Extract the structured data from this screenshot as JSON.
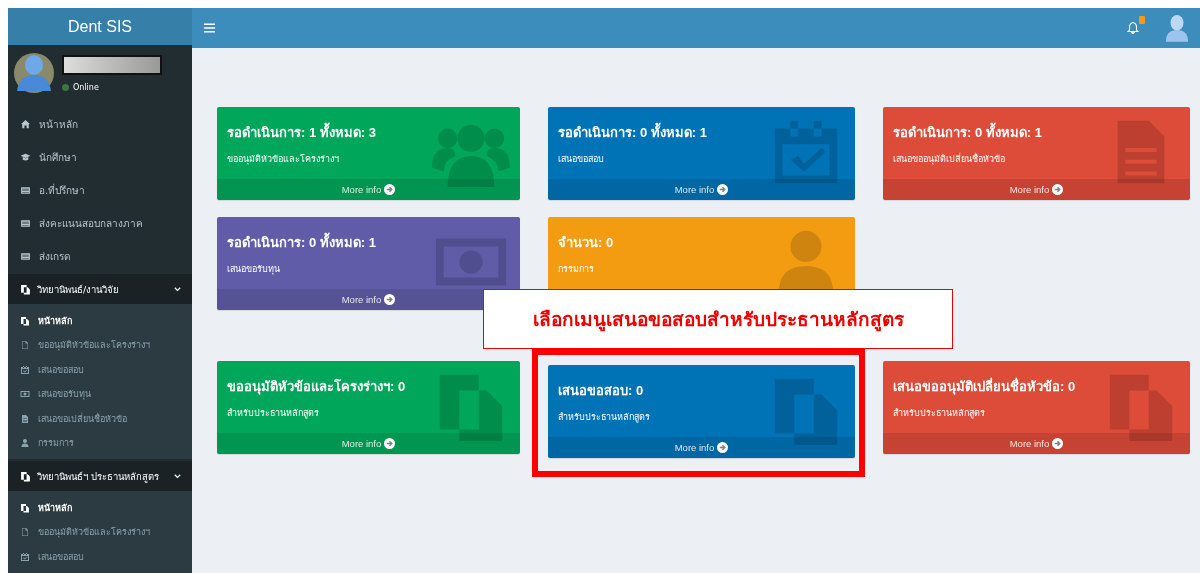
{
  "brand": "Dent SIS",
  "user": {
    "status": "Online"
  },
  "notifications": {
    "unread": true
  },
  "menu": [
    {
      "label": "หน้าหลัก"
    },
    {
      "label": "นักศึกษา"
    },
    {
      "label": "อ.ที่ปรึกษา"
    },
    {
      "label": "ส่งคะแนนสอบกลางภาค"
    },
    {
      "label": "ส่งเกรด"
    }
  ],
  "sections": [
    {
      "label": "วิทยานิพนธ์/งานวิจัย",
      "expanded": true,
      "items": [
        {
          "label": "หน้าหลัก",
          "selected": true
        },
        {
          "label": "ขออนุมัติหัวข้อและโครงร่างฯ",
          "selected": false
        },
        {
          "label": "เสนอขอสอบ",
          "selected": false
        },
        {
          "label": "เสนอขอรับทุน",
          "selected": false
        },
        {
          "label": "เสนอขอเปลี่ยนชื่อหัวข้อ",
          "selected": false
        },
        {
          "label": "กรรมการ",
          "selected": false
        }
      ]
    },
    {
      "label": "วิทยานิพนธ์ฯ ประธานหลักสูตร",
      "expanded": true,
      "items": [
        {
          "label": "หน้าหลัก",
          "selected": true
        },
        {
          "label": "ขออนุมัติหัวข้อและโครงร่างฯ",
          "selected": false
        },
        {
          "label": "เสนอขอสอบ",
          "selected": false
        }
      ]
    }
  ],
  "cards": [
    {
      "title": "รอดำเนินการ: 1 ทั้งหมด: 3",
      "subtitle": "ขออนุมัติหัวข้อและโครงร่างฯ",
      "color": "#00a65a",
      "footer": "More info"
    },
    {
      "title": "รอดำเนินการ: 0 ทั้งหมด: 1",
      "subtitle": "เสนอขอสอบ",
      "color": "#0073b7",
      "footer": "More info"
    },
    {
      "title": "รอดำเนินการ: 0 ทั้งหมด: 1",
      "subtitle": "เสนอขออนุมัติเปลี่ยนชื่อหัวข้อ",
      "color": "#dd4b39",
      "footer": "More info"
    },
    {
      "title": "รอดำเนินการ: 0 ทั้งหมด: 1",
      "subtitle": "เสนอขอรับทุน",
      "color": "#605ca8",
      "footer": "More info"
    },
    {
      "title": "จำนวน: 0",
      "subtitle": "กรรมการ",
      "color": "#f39c12"
    }
  ],
  "chair_cards": [
    {
      "title": "ขออนุมัติหัวข้อและโครงร่างฯ: 0",
      "subtitle": "สำหรับประธานหลักสูตร",
      "color": "#00a65a",
      "footer": "More info",
      "highlighted": false
    },
    {
      "title": "เสนอขอสอบ: 0",
      "subtitle": "สำหรับประธานหลักสูตร",
      "color": "#0073b7",
      "footer": "More info",
      "highlighted": true
    },
    {
      "title": "เสนอขออนุมัติเปลี่ยนชื่อหัวข้อ: 0",
      "subtitle": "สำหรับประธานหลักสูตร",
      "color": "#dd4b39",
      "footer": "More info",
      "highlighted": false
    }
  ],
  "callout": {
    "text": "เลือกเมนูเสนอขอสอบสำหรับประธานหลักสูตร"
  }
}
